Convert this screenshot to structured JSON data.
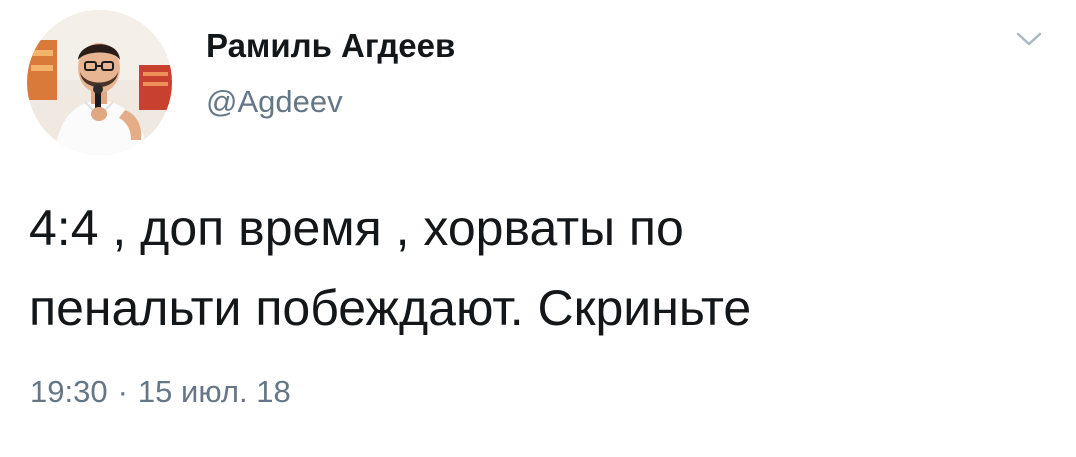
{
  "user": {
    "display_name": "Рамиль Агдеев",
    "handle": "@Agdeev",
    "avatar_icon": "user-avatar-photo"
  },
  "tweet": {
    "text_lines": [
      "4:4 , доп время , хорваты по",
      "пенальти побеждают. Скриньте"
    ],
    "time": "19:30",
    "separator": "·",
    "date": "15 июл. 18"
  },
  "menu": {
    "icon": "chevron-down-icon"
  },
  "colors": {
    "text": "#14171a",
    "secondary": "#657786",
    "background": "#ffffff"
  }
}
